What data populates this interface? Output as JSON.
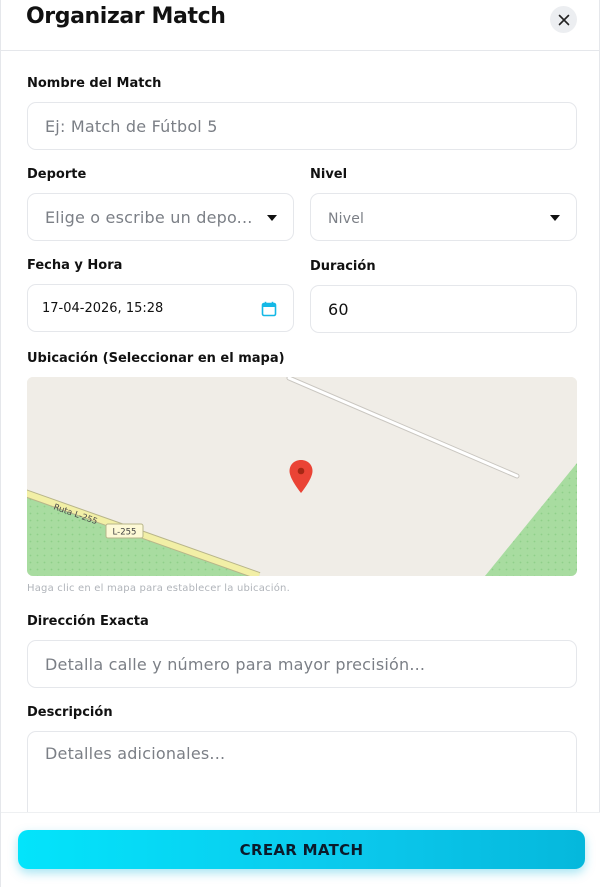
{
  "modal": {
    "title": "Organizar Match"
  },
  "form": {
    "name": {
      "label": "Nombre del Match",
      "placeholder": "Ej: Match de Fútbol 5"
    },
    "sport": {
      "label": "Deporte",
      "placeholder": "Elige o escribe un depo..."
    },
    "level": {
      "label": "Nivel",
      "selected": "Nivel"
    },
    "datetime": {
      "label": "Fecha y Hora",
      "value": "17-04-2026, 15:28"
    },
    "duration": {
      "label": "Duración",
      "value": "60"
    },
    "location": {
      "label": "Ubicación (Seleccionar en el mapa)",
      "map_road_label": "Ruta L-255",
      "map_road_shield": "L-255",
      "hint": "Haga clic en el mapa para establecer la ubicación."
    },
    "address": {
      "label": "Dirección Exacta",
      "placeholder": "Detalla calle y número para mayor precisión..."
    },
    "description": {
      "label": "Descripción",
      "placeholder": "Detalles adicionales..."
    },
    "submit_label": "CREAR MATCH"
  },
  "colors": {
    "accent": "#0bc8ec",
    "calendar_icon": "#14b8e6",
    "map_pin": "#ea4335",
    "map_green": "#a8dca0",
    "map_road": "#f2efa6"
  }
}
